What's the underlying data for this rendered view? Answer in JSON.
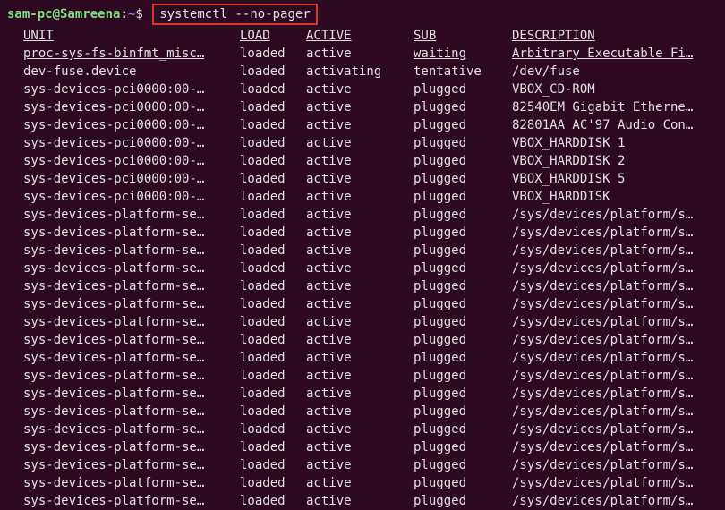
{
  "prompt": {
    "user": "sam-pc@Samreena",
    "colon": ":",
    "path": "~",
    "dollar": "$",
    "command": "systemctl --no-pager"
  },
  "headers": {
    "unit": "UNIT",
    "load": "LOAD",
    "active": "ACTIVE",
    "sub": "SUB",
    "description": "DESCRIPTION"
  },
  "rows": [
    {
      "unit": "proc-sys-fs-binfmt_misc…",
      "load": "loaded",
      "active": "active",
      "sub": "waiting",
      "desc": "Arbitrary Executable Fi…",
      "underlined": true
    },
    {
      "unit": "dev-fuse.device",
      "load": "loaded",
      "active": "activating",
      "sub": "tentative",
      "desc": "/dev/fuse"
    },
    {
      "unit": "sys-devices-pci0000:00-…",
      "load": "loaded",
      "active": "active",
      "sub": "plugged",
      "desc": "VBOX_CD-ROM"
    },
    {
      "unit": "sys-devices-pci0000:00-…",
      "load": "loaded",
      "active": "active",
      "sub": "plugged",
      "desc": "82540EM Gigabit Etherne…"
    },
    {
      "unit": "sys-devices-pci0000:00-…",
      "load": "loaded",
      "active": "active",
      "sub": "plugged",
      "desc": "82801AA AC'97 Audio Con…"
    },
    {
      "unit": "sys-devices-pci0000:00-…",
      "load": "loaded",
      "active": "active",
      "sub": "plugged",
      "desc": "VBOX_HARDDISK 1"
    },
    {
      "unit": "sys-devices-pci0000:00-…",
      "load": "loaded",
      "active": "active",
      "sub": "plugged",
      "desc": "VBOX_HARDDISK 2"
    },
    {
      "unit": "sys-devices-pci0000:00-…",
      "load": "loaded",
      "active": "active",
      "sub": "plugged",
      "desc": "VBOX_HARDDISK 5"
    },
    {
      "unit": "sys-devices-pci0000:00-…",
      "load": "loaded",
      "active": "active",
      "sub": "plugged",
      "desc": "VBOX_HARDDISK"
    },
    {
      "unit": "sys-devices-platform-se…",
      "load": "loaded",
      "active": "active",
      "sub": "plugged",
      "desc": "/sys/devices/platform/s…"
    },
    {
      "unit": "sys-devices-platform-se…",
      "load": "loaded",
      "active": "active",
      "sub": "plugged",
      "desc": "/sys/devices/platform/s…"
    },
    {
      "unit": "sys-devices-platform-se…",
      "load": "loaded",
      "active": "active",
      "sub": "plugged",
      "desc": "/sys/devices/platform/s…"
    },
    {
      "unit": "sys-devices-platform-se…",
      "load": "loaded",
      "active": "active",
      "sub": "plugged",
      "desc": "/sys/devices/platform/s…"
    },
    {
      "unit": "sys-devices-platform-se…",
      "load": "loaded",
      "active": "active",
      "sub": "plugged",
      "desc": "/sys/devices/platform/s…"
    },
    {
      "unit": "sys-devices-platform-se…",
      "load": "loaded",
      "active": "active",
      "sub": "plugged",
      "desc": "/sys/devices/platform/s…"
    },
    {
      "unit": "sys-devices-platform-se…",
      "load": "loaded",
      "active": "active",
      "sub": "plugged",
      "desc": "/sys/devices/platform/s…"
    },
    {
      "unit": "sys-devices-platform-se…",
      "load": "loaded",
      "active": "active",
      "sub": "plugged",
      "desc": "/sys/devices/platform/s…"
    },
    {
      "unit": "sys-devices-platform-se…",
      "load": "loaded",
      "active": "active",
      "sub": "plugged",
      "desc": "/sys/devices/platform/s…"
    },
    {
      "unit": "sys-devices-platform-se…",
      "load": "loaded",
      "active": "active",
      "sub": "plugged",
      "desc": "/sys/devices/platform/s…"
    },
    {
      "unit": "sys-devices-platform-se…",
      "load": "loaded",
      "active": "active",
      "sub": "plugged",
      "desc": "/sys/devices/platform/s…"
    },
    {
      "unit": "sys-devices-platform-se…",
      "load": "loaded",
      "active": "active",
      "sub": "plugged",
      "desc": "/sys/devices/platform/s…"
    },
    {
      "unit": "sys-devices-platform-se…",
      "load": "loaded",
      "active": "active",
      "sub": "plugged",
      "desc": "/sys/devices/platform/s…"
    },
    {
      "unit": "sys-devices-platform-se…",
      "load": "loaded",
      "active": "active",
      "sub": "plugged",
      "desc": "/sys/devices/platform/s…"
    },
    {
      "unit": "sys-devices-platform-se…",
      "load": "loaded",
      "active": "active",
      "sub": "plugged",
      "desc": "/sys/devices/platform/s…"
    },
    {
      "unit": "sys-devices-platform-se…",
      "load": "loaded",
      "active": "active",
      "sub": "plugged",
      "desc": "/sys/devices/platform/s…"
    },
    {
      "unit": "sys-devices-platform-se…",
      "load": "loaded",
      "active": "active",
      "sub": "plugged",
      "desc": "/sys/devices/platform/s…"
    }
  ]
}
